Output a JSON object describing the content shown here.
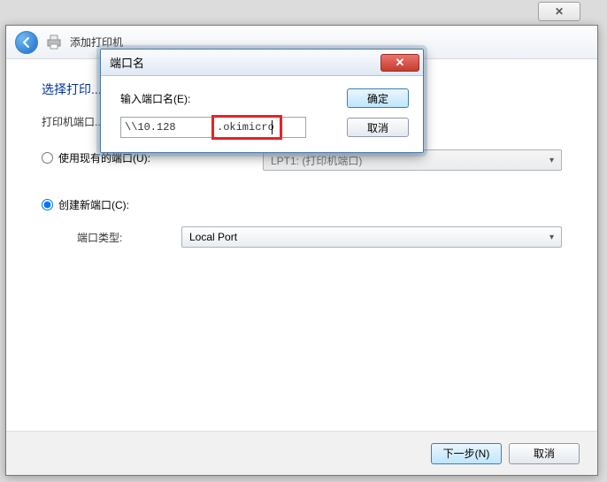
{
  "outer": {
    "close": "✕"
  },
  "wizard": {
    "title": "添加打印机",
    "sectionHead": "选择打印...",
    "subtext": "打印机端口...",
    "useExisting": "使用现有的端口(U):",
    "existingValue": "LPT1: (打印机端口)",
    "createNew": "创建新端口(C):",
    "portTypeLabel": "端口类型:",
    "portTypeValue": "Local Port",
    "next": "下一步(N)",
    "cancel": "取消"
  },
  "modal": {
    "title": "端口名",
    "label": "输入端口名(E):",
    "valuePart1": "\\\\10.128",
    "valuePart2": ".okimicro",
    "ok": "确定",
    "cancel": "取消",
    "close": "✕"
  }
}
